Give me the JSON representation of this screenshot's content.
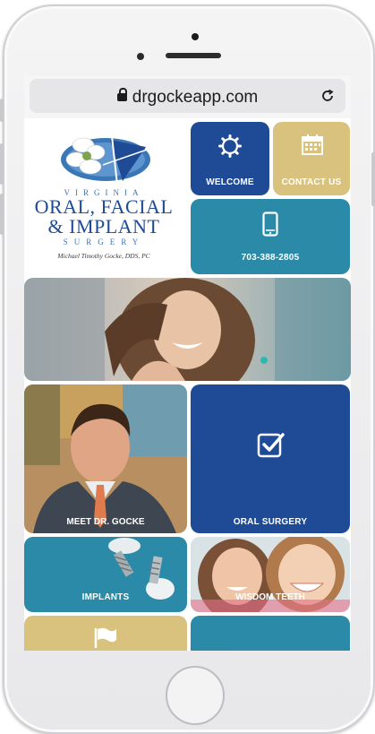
{
  "browser": {
    "url": "drgockeapp.com"
  },
  "logo": {
    "state": "VIRGINIA",
    "line1": "ORAL, FACIAL",
    "line2": "& IMPLANT",
    "subtitle": "SURGERY",
    "doctor": "Michael Timothy Gocke, DDS, PC"
  },
  "tiles": {
    "welcome": "WELCOME",
    "contact": "CONTACT US",
    "phone": "703-388-2805",
    "meet": "MEET DR. GOCKE",
    "oral_surgery": "ORAL SURGERY",
    "implants": "IMPLANTS",
    "wisdom": "WISDOM TEETH"
  },
  "icons": {
    "welcome": "gear-icon",
    "contact": "calendar-icon",
    "phone": "phone-icon",
    "oral_surgery": "checkbox-icon",
    "bottom_left": "flag-icon"
  },
  "colors": {
    "navy": "#1f4b96",
    "teal": "#2b8aa7",
    "gold": "#d8c27d"
  }
}
